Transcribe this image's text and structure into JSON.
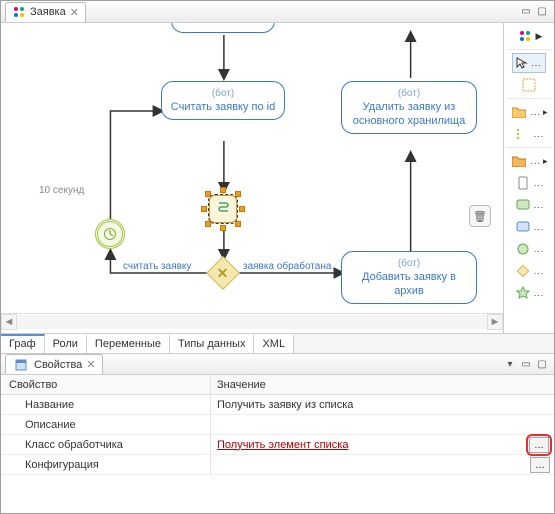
{
  "editor": {
    "tab_title": "Заявка",
    "bottom_tabs": [
      "Граф",
      "Роли",
      "Переменные",
      "Типы данных",
      "XML"
    ]
  },
  "diagram": {
    "timer_label": "10 секунд",
    "node_read": {
      "bot": "(бот)",
      "label": "Считать заявку по id"
    },
    "node_delete": {
      "bot": "(бот)",
      "label": "Удалить заявку из основного хранилища"
    },
    "node_archive": {
      "bot": "(бот)",
      "label": "Добавить заявку в архив"
    },
    "edge_left_label": "считать заявку",
    "edge_right_label": "заявка обработана"
  },
  "properties": {
    "pane_title": "Свойства",
    "col_property": "Свойство",
    "col_value": "Значение",
    "rows": {
      "name": {
        "label": "Название",
        "value": "Получить заявку из списка"
      },
      "desc": {
        "label": "Описание",
        "value": ""
      },
      "class": {
        "label": "Класс обработчика",
        "value": "Получить элемент списка"
      },
      "config": {
        "label": "Конфигурация",
        "value": ""
      }
    }
  },
  "icons": {
    "ellipsis": "..."
  }
}
